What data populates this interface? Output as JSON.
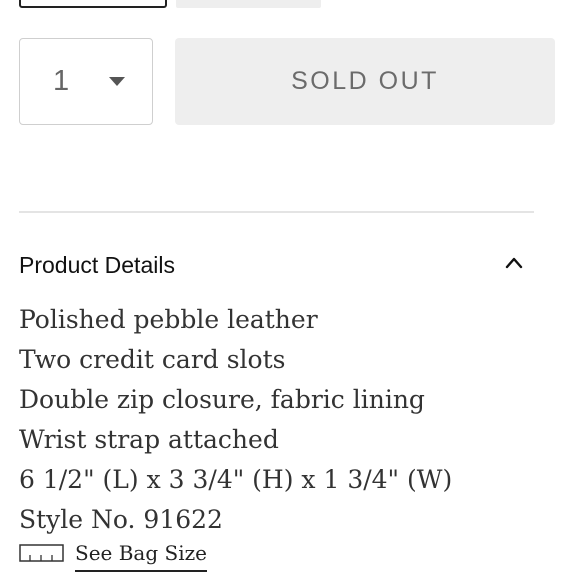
{
  "product_form": {
    "quantity": {
      "value": "1"
    },
    "add_to_cart_label": "SOLD OUT"
  },
  "product_details": {
    "title": "Product Details",
    "expanded": true,
    "items": [
      "Polished pebble leather",
      "Two credit card slots",
      "Double zip closure, fabric lining",
      "Wrist strap attached",
      "6 1/2\" (L) x 3 3/4\" (H) x 1 3/4\" (W)",
      "Style No. 91622"
    ]
  },
  "bag_size_link": {
    "label": "See Bag Size",
    "icon": "ruler-icon"
  },
  "colors": {
    "button_bg": "#eeeeee",
    "button_text": "#6b6b6b",
    "divider": "#e4e4e4",
    "text": "#333333"
  }
}
